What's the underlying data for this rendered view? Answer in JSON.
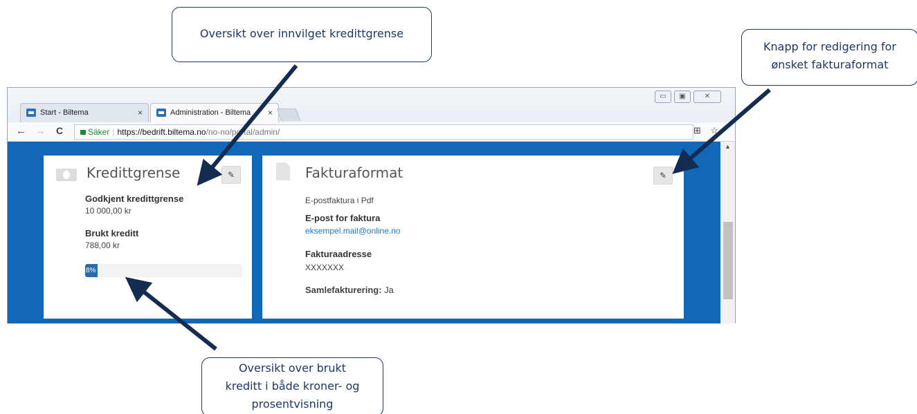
{
  "browser": {
    "tabs": [
      {
        "label": "Start - Biltema",
        "close": "×"
      },
      {
        "label": "Administration - Biltema",
        "close": "×"
      }
    ],
    "nav": {
      "back": "←",
      "forward": "→",
      "reload": "C"
    },
    "url": {
      "secure_label": "Säker",
      "host": "https://bedrift.biltema.no",
      "path": "/no-no/portal/admin/"
    },
    "window_controls": {
      "minimize": "▭",
      "restore": "▣",
      "close": "✕"
    },
    "addr_icons": {
      "translate": "⊞",
      "star": "☆"
    }
  },
  "credit_card": {
    "title": "Kredittgrense",
    "edit_icon": "✎",
    "approved_label": "Godkjent kredittgrense",
    "approved_value": "10 000,00 kr",
    "used_label": "Brukt kreditt",
    "used_value": "788,00 kr",
    "progress": {
      "percent": 8,
      "label": "8%"
    }
  },
  "invoice_card": {
    "title": "Fakturaformat",
    "edit_icon": "✎",
    "format": "E-postfaktura i Pdf",
    "email_label": "E-post for faktura",
    "email_value": "eksempel.mail@online.no",
    "address_label": "Fakturaadresse",
    "address_value": "XXXXXXX",
    "consolidated_label": "Samlefakturering:",
    "consolidated_value": " Ja"
  },
  "callouts": {
    "credit_limit": "Oversikt over innvilget kredittgrense",
    "edit_button": [
      "Knapp for redigering for",
      "ønsket fakturaformat"
    ],
    "used_credit": [
      "Oversikt over brukt",
      "kreditt i både kroner- og",
      "prosentvisning"
    ]
  },
  "colors": {
    "page_blue": "#1168b8",
    "callout_navy": "#1f3864",
    "progress_fill": "#2b6aad",
    "link": "#1f7acb"
  }
}
